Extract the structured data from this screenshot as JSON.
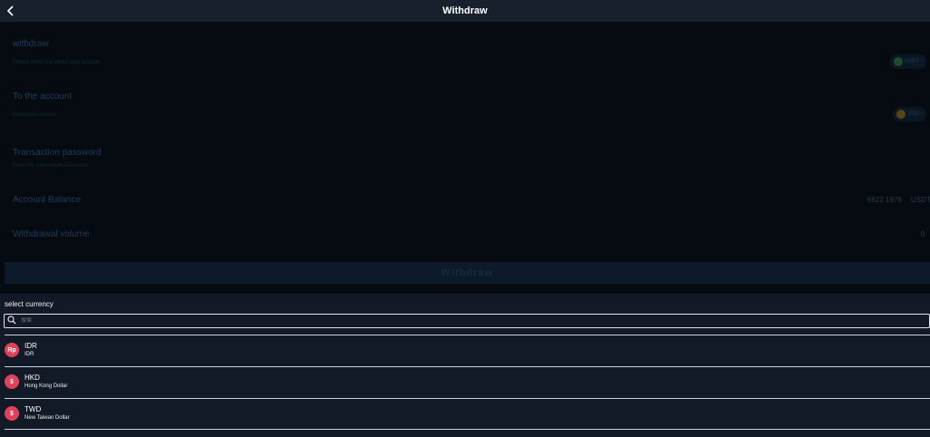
{
  "header": {
    "title": "Withdraw"
  },
  "form": {
    "withdraw": {
      "label": "withdraw",
      "hint": "Please enter the withdrawal amount",
      "currency": "USDT"
    },
    "to_account": {
      "label": "To the account",
      "hint": "Estimated amount",
      "currency": "USD"
    },
    "password": {
      "label": "Transaction password",
      "hint": "Enter the transaction password"
    },
    "balance": {
      "label": "Account Balance",
      "value": "6622.1979",
      "unit": "USDT"
    },
    "volume": {
      "label": "Withdrawal volume",
      "value": "0"
    },
    "submit_label": "Withdraw"
  },
  "currency_panel": {
    "title": "select currency",
    "search_placeholder": "搜索",
    "items": [
      {
        "code": "IDR",
        "name": "IDR",
        "badge": "Rp"
      },
      {
        "code": "HKD",
        "name": "Hong Kong Dollar",
        "badge": "$"
      },
      {
        "code": "TWD",
        "name": "New Taiwan Dollar",
        "badge": "$"
      }
    ]
  },
  "colors": {
    "badge": "#e0405a",
    "panel_bg": "#111a26",
    "overlay_bg": "#060b12"
  }
}
